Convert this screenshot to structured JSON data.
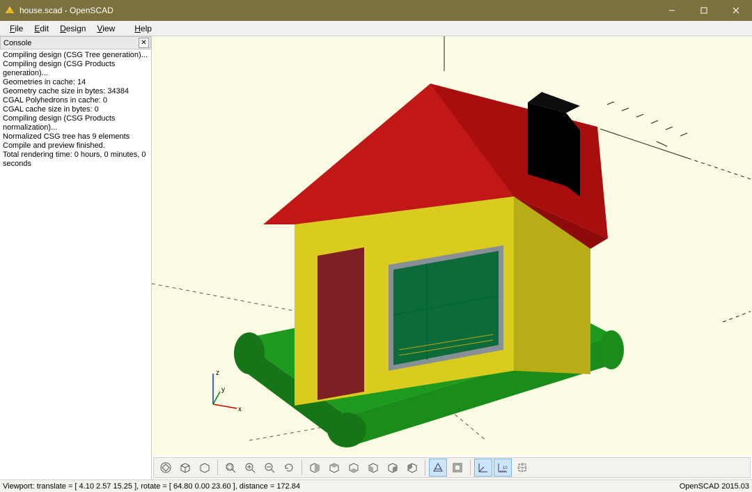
{
  "window": {
    "title": "house.scad - OpenSCAD"
  },
  "menu": {
    "file": "File",
    "edit": "Edit",
    "design": "Design",
    "view": "View",
    "help": "Help"
  },
  "console": {
    "title": "Console",
    "lines": [
      "Compiling design (CSG Tree generation)...",
      "Compiling design (CSG Products generation)...",
      "Geometries in cache: 14",
      "Geometry cache size in bytes: 34384",
      "CGAL Polyhedrons in cache: 0",
      "CGAL cache size in bytes: 0",
      "Compiling design (CSG Products normalization)...",
      "Normalized CSG tree has 9 elements",
      "Compile and preview finished.",
      "Total rendering time: 0 hours, 0 minutes, 0 seconds"
    ]
  },
  "axes": {
    "x": "x",
    "y": "y",
    "z": "z"
  },
  "toolbar": {
    "preview": "preview",
    "render": "render",
    "view_all": "view-all",
    "zoom_in": "zoom-in",
    "zoom_out": "zoom-out",
    "reset_view": "reset-view",
    "right": "right",
    "top": "top",
    "bottom": "bottom",
    "left": "left",
    "front": "front",
    "back": "back",
    "perspective": "perspective",
    "orthogonal": "orthogonal",
    "axes_on": "show-axes",
    "scale_marker": "show-scale",
    "crosshairs": "show-crosshairs"
  },
  "status": {
    "viewport": "Viewport: translate = [ 4.10 2.57 15.25 ], rotate = [ 64.80 0.00 23.60 ], distance = 172.84",
    "version": "OpenSCAD 2015.03"
  }
}
